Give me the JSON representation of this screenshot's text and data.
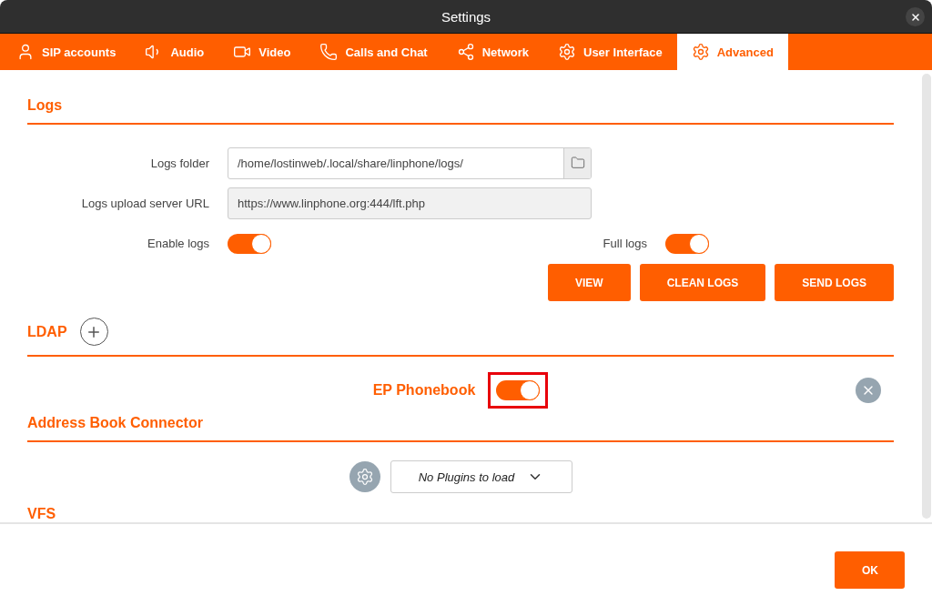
{
  "window": {
    "title": "Settings"
  },
  "tabs": [
    {
      "label": "SIP accounts",
      "selected": false
    },
    {
      "label": "Audio",
      "selected": false
    },
    {
      "label": "Video",
      "selected": false
    },
    {
      "label": "Calls and Chat",
      "selected": false
    },
    {
      "label": "Network",
      "selected": false
    },
    {
      "label": "User Interface",
      "selected": false
    },
    {
      "label": "Advanced",
      "selected": true
    }
  ],
  "logs": {
    "heading": "Logs",
    "folder_label": "Logs folder",
    "folder_value": "/home/lostinweb/.local/share/linphone/logs/",
    "url_label": "Logs upload server URL",
    "url_value": "https://www.linphone.org:444/lft.php",
    "enable_label": "Enable logs",
    "enable_on": true,
    "full_label": "Full logs",
    "full_on": true,
    "buttons": [
      "VIEW",
      "CLEAN LOGS",
      "SEND LOGS"
    ]
  },
  "ldap": {
    "heading": "LDAP",
    "entries": [
      {
        "name": "EP Phonebook",
        "on": true,
        "highlighted": true
      }
    ]
  },
  "address_book": {
    "heading": "Address Book Connector",
    "plugin_select": "No Plugins to load"
  },
  "vfs": {
    "heading": "VFS"
  },
  "footer": {
    "ok": "OK"
  }
}
